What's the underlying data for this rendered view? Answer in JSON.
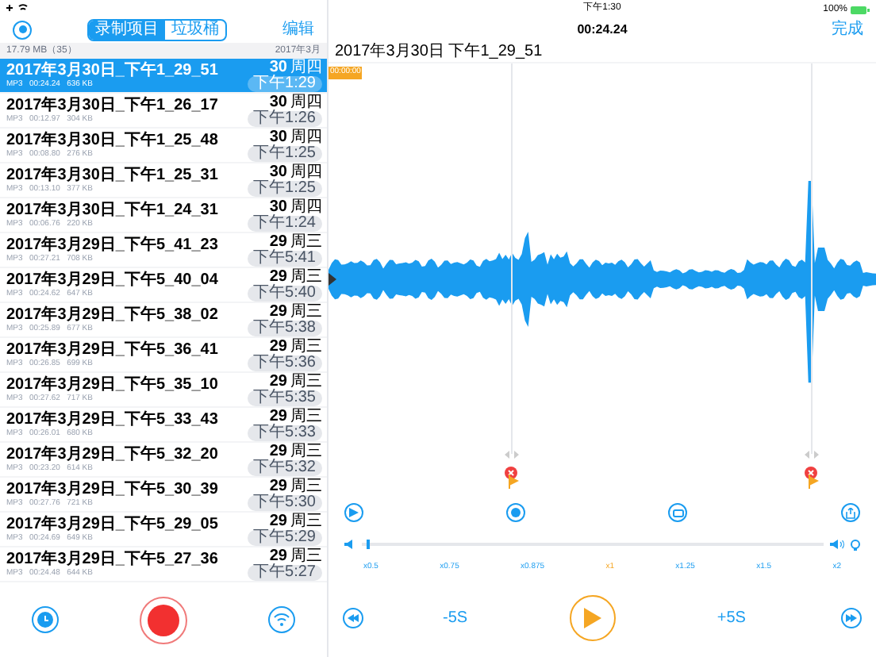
{
  "left": {
    "tabs": [
      {
        "label": "录制项目",
        "selected": true
      },
      {
        "label": "垃圾桶",
        "selected": false
      }
    ],
    "edit": "编辑",
    "summary": "17.79 MB（35）",
    "month": "2017年3月",
    "rows": [
      {
        "title": "2017年3月30日_下午1_29_51",
        "meta": "MP3   00:24.24   636 KB",
        "day": "30",
        "weekday": "周四",
        "time": "下午1:29",
        "selected": true
      },
      {
        "title": "2017年3月30日_下午1_26_17",
        "meta": "MP3   00:12.97   304 KB",
        "day": "30",
        "weekday": "周四",
        "time": "下午1:26",
        "selected": false
      },
      {
        "title": "2017年3月30日_下午1_25_48",
        "meta": "MP3   00:08.80   276 KB",
        "day": "30",
        "weekday": "周四",
        "time": "下午1:25",
        "selected": false
      },
      {
        "title": "2017年3月30日_下午1_25_31",
        "meta": "MP3   00:13.10   377 KB",
        "day": "30",
        "weekday": "周四",
        "time": "下午1:25",
        "selected": false
      },
      {
        "title": "2017年3月30日_下午1_24_31",
        "meta": "MP3   00:06.76   220 KB",
        "day": "30",
        "weekday": "周四",
        "time": "下午1:24",
        "selected": false
      },
      {
        "title": "2017年3月29日_下午5_41_23",
        "meta": "MP3   00:27.21   708 KB",
        "day": "29",
        "weekday": "周三",
        "time": "下午5:41",
        "selected": false
      },
      {
        "title": "2017年3月29日_下午5_40_04",
        "meta": "MP3   00:24.62   647 KB",
        "day": "29",
        "weekday": "周三",
        "time": "下午5:40",
        "selected": false
      },
      {
        "title": "2017年3月29日_下午5_38_02",
        "meta": "MP3   00:25.89   677 KB",
        "day": "29",
        "weekday": "周三",
        "time": "下午5:38",
        "selected": false
      },
      {
        "title": "2017年3月29日_下午5_36_41",
        "meta": "MP3   00:26.85   699 KB",
        "day": "29",
        "weekday": "周三",
        "time": "下午5:36",
        "selected": false
      },
      {
        "title": "2017年3月29日_下午5_35_10",
        "meta": "MP3   00:27.62   717 KB",
        "day": "29",
        "weekday": "周三",
        "time": "下午5:35",
        "selected": false
      },
      {
        "title": "2017年3月29日_下午5_33_43",
        "meta": "MP3   00:26.01   680 KB",
        "day": "29",
        "weekday": "周三",
        "time": "下午5:33",
        "selected": false
      },
      {
        "title": "2017年3月29日_下午5_32_20",
        "meta": "MP3   00:23.20   614 KB",
        "day": "29",
        "weekday": "周三",
        "time": "下午5:32",
        "selected": false
      },
      {
        "title": "2017年3月29日_下午5_30_39",
        "meta": "MP3   00:27.76   721 KB",
        "day": "29",
        "weekday": "周三",
        "time": "下午5:30",
        "selected": false
      },
      {
        "title": "2017年3月29日_下午5_29_05",
        "meta": "MP3   00:24.69   649 KB",
        "day": "29",
        "weekday": "周三",
        "time": "下午5:29",
        "selected": false
      },
      {
        "title": "2017年3月29日_下午5_27_36",
        "meta": "MP3   00:24.48   644 KB",
        "day": "29",
        "weekday": "周三",
        "time": "下午5:27",
        "selected": false
      }
    ]
  },
  "right": {
    "clock": "下午1:30",
    "battery": "100%",
    "elapsed": "00:24.24",
    "done": "完成",
    "filename": "2017年3月30日 下午1_29_51",
    "start_marker": "00:00:00",
    "volume": {
      "level": 0.01
    },
    "speeds": [
      {
        "label": "x0.5",
        "selected": false
      },
      {
        "label": "x0.75",
        "selected": false
      },
      {
        "label": "x0.875",
        "selected": false
      },
      {
        "label": "x1",
        "selected": true
      },
      {
        "label": "x1.25",
        "selected": false
      },
      {
        "label": "x1.5",
        "selected": false
      },
      {
        "label": "x2",
        "selected": false
      }
    ],
    "back": "-5S",
    "forward": "+5S"
  }
}
